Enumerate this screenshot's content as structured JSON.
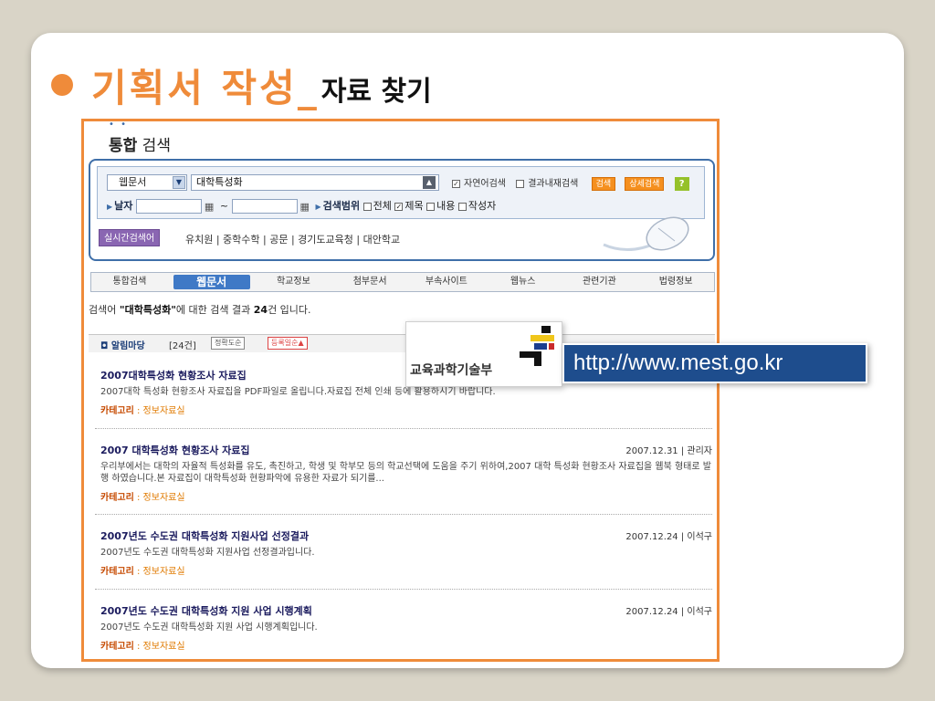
{
  "slide": {
    "title_big": "기획서 작성_",
    "title_small": "자료 찾기",
    "accent_color": "#ef8b3a"
  },
  "header": {
    "bold": "통합",
    "rest": " 검색",
    "dots": "• •"
  },
  "search": {
    "scope_select": "웹문서",
    "query": "대학특성화",
    "options": [
      "자연어검색",
      "결과내재검색"
    ],
    "search_button": "검색",
    "detail_button": "상세검색",
    "help_button": "?",
    "date_label": "날자",
    "date_sep": "~",
    "range_label": "검색범위",
    "range_options": [
      {
        "label": "전체",
        "checked": false
      },
      {
        "label": "제목",
        "checked": true
      },
      {
        "label": "내용",
        "checked": false
      },
      {
        "label": "작성자",
        "checked": false
      }
    ],
    "realtime_button": "실시간검색어",
    "keywords": "유치원 | 중학수학 | 공문 | 경기도교육청 | 대안학교"
  },
  "tabs": [
    "통합검색",
    "웹문서",
    "학교정보",
    "첨부문서",
    "부속사이트",
    "웹뉴스",
    "관련기관",
    "법령정보"
  ],
  "active_tab": "웹문서",
  "summary": {
    "prefix": "검색어 ",
    "query": "\"대학특성화\"",
    "middle": "에 대한 검색 결과 ",
    "count": "24",
    "suffix": "건 입니다."
  },
  "results_bar": {
    "label": "알림마당",
    "count": "[24건]",
    "sort1": "정확도순",
    "sort2": "등록일순▲"
  },
  "results": [
    {
      "title": "2007대학특성화 현황조사 자료집",
      "desc": "2007대학 특성화 현황조사 자료집을 PDF파일로 올립니다.자료집 전체 인쇄 등에 활용하시기 바랍니다.",
      "meta": "",
      "category_label": "카테고리",
      "category": " : 정보자료실"
    },
    {
      "title": "2007 대학특성화 현황조사 자료집",
      "desc": "우리부에서는 대학의 자율적 특성화를 유도, 촉진하고, 학생 및 학부모 등의 학교선택에 도움을 주기 위하여,2007 대학 특성화 현황조사 자료집을 웹북 형태로 발행 하였습니다.본 자료집이 대학특성화 현황파악에 유용한 자료가 되기를...",
      "meta": "2007.12.31 | 관리자",
      "category_label": "카테고리",
      "category": " : 정보자료실"
    },
    {
      "title": "2007년도 수도권 대학특성화 지원사업 선정결과",
      "desc": "2007년도 수도권 대학특성화 지원사업 선정결과입니다.",
      "meta": "2007.12.24 | 이석구",
      "category_label": "카테고리",
      "category": " : 정보자료실"
    },
    {
      "title": "2007년도 수도권 대학특성화 지원 사업 시행계획",
      "desc": "2007년도 수도권 대학특성화 지원 사업 시행계획입니다.",
      "meta": "2007.12.24 | 이석구",
      "category_label": "카테고리",
      "category": " : 정보자료실"
    }
  ],
  "overlay": {
    "logo_text": "교육과학기술부",
    "url": "http://www.mest.go.kr"
  }
}
